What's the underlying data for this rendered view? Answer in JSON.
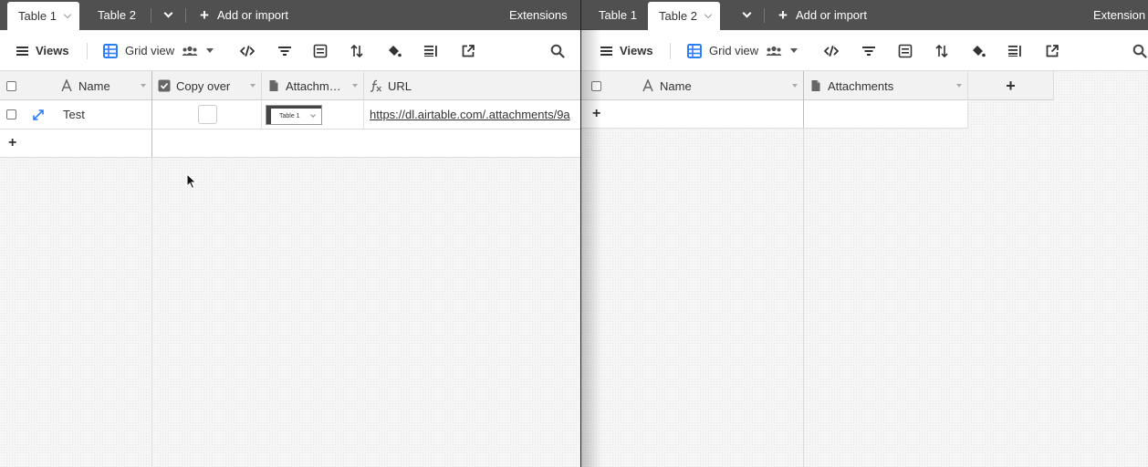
{
  "left_pane": {
    "tabs": [
      {
        "label": "Table 1",
        "active": true
      },
      {
        "label": "Table 2",
        "active": false
      }
    ],
    "add_import_label": "Add or import",
    "extensions_label": "Extensions",
    "toolbar": {
      "views_label": "Views",
      "view_name": "Grid view",
      "icons": [
        "collaborator-icon",
        "hide-fields-icon",
        "filter-icon",
        "group-icon",
        "sort-icon",
        "color-icon",
        "row-height-icon",
        "share-view-icon",
        "search-icon"
      ]
    },
    "columns": [
      {
        "label": "Name",
        "type": "text"
      },
      {
        "label": "Copy over",
        "type": "checkbox"
      },
      {
        "label": "Attachm…",
        "type": "attachment"
      },
      {
        "label": "URL",
        "type": "formula"
      }
    ],
    "rows": [
      {
        "name": "Test",
        "copy_over": false,
        "attachment_thumb_label": "Table 1",
        "url": "https://dl.airtable.com/.attachments/9a"
      }
    ],
    "add_row_label": "+"
  },
  "right_pane": {
    "tabs": [
      {
        "label": "Table 1",
        "active": false
      },
      {
        "label": "Table 2",
        "active": true
      }
    ],
    "add_import_label": "Add or import",
    "extensions_label": "Extension",
    "toolbar": {
      "views_label": "Views",
      "view_name": "Grid view"
    },
    "columns": [
      {
        "label": "Name",
        "type": "text"
      },
      {
        "label": "Attachments",
        "type": "attachment"
      }
    ],
    "add_field_label": "+",
    "add_row_label": "+"
  },
  "colors": {
    "tabbar_bg": "#505050",
    "accent_blue": "#2d7ff9",
    "header_bg": "#f2f2f2"
  }
}
